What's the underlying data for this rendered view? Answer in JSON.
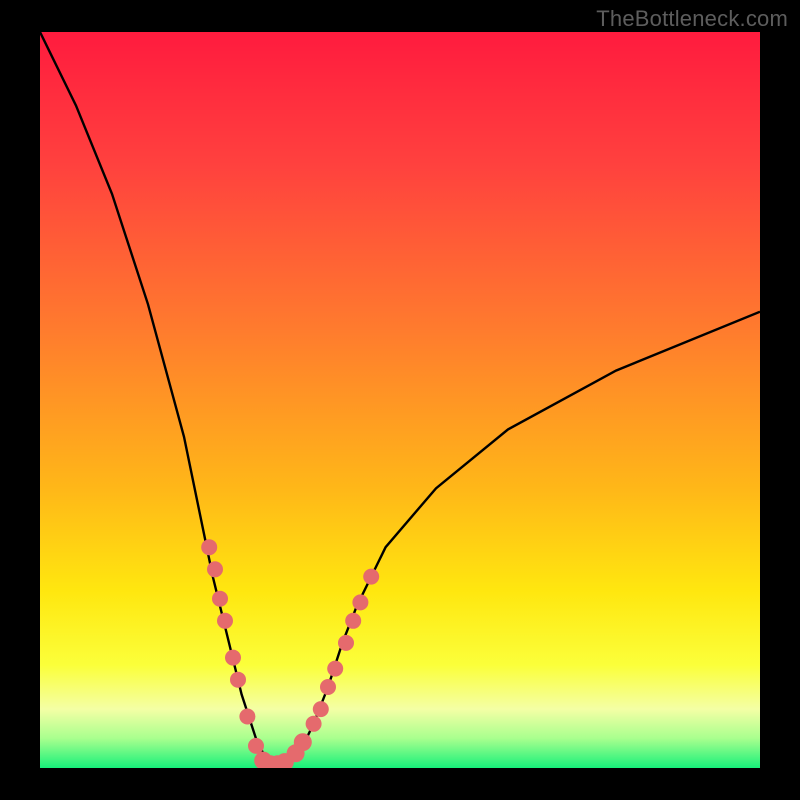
{
  "watermark": "TheBottleneck.com",
  "gradient_stops": {
    "c0": "#ff1b3e",
    "c1": "#ff413e",
    "c2": "#ff7a2e",
    "c3": "#ffb718",
    "c4": "#ffe70f",
    "c5": "#fbff3a",
    "c6": "#f4ffa5",
    "c7": "#a8ff8e",
    "c8": "#17f07a"
  },
  "chart_data": {
    "type": "line",
    "title": "",
    "xlabel": "",
    "ylabel": "",
    "x": [
      0,
      5,
      10,
      15,
      20,
      24,
      26,
      28,
      30,
      32,
      34,
      36,
      38,
      40,
      42,
      44,
      48,
      55,
      65,
      80,
      100
    ],
    "values": [
      100,
      90,
      78,
      63,
      45,
      26,
      18,
      10,
      4,
      0,
      0,
      2,
      6,
      11,
      17,
      22,
      30,
      38,
      46,
      54,
      62
    ],
    "ylim": [
      0,
      100
    ],
    "xlim": [
      0,
      100
    ],
    "series_notes": "V-shaped bottleneck curve; minimum near x≈32 reaching y≈0; left arm steeper than right.",
    "markers": {
      "left_arm": [
        {
          "x": 23.5,
          "y": 30
        },
        {
          "x": 24.3,
          "y": 27
        },
        {
          "x": 25.0,
          "y": 23
        },
        {
          "x": 25.7,
          "y": 20
        },
        {
          "x": 26.8,
          "y": 15
        },
        {
          "x": 27.5,
          "y": 12
        },
        {
          "x": 28.8,
          "y": 7
        },
        {
          "x": 30.0,
          "y": 3
        }
      ],
      "bottom": [
        {
          "x": 31.0,
          "y": 1
        },
        {
          "x": 32.0,
          "y": 0.5
        },
        {
          "x": 33.0,
          "y": 0.5
        },
        {
          "x": 34.0,
          "y": 0.8
        },
        {
          "x": 35.5,
          "y": 2
        },
        {
          "x": 36.5,
          "y": 3.5
        }
      ],
      "right_arm": [
        {
          "x": 38.0,
          "y": 6
        },
        {
          "x": 39.0,
          "y": 8
        },
        {
          "x": 40.0,
          "y": 11
        },
        {
          "x": 41.0,
          "y": 13.5
        },
        {
          "x": 42.5,
          "y": 17
        },
        {
          "x": 43.5,
          "y": 20
        },
        {
          "x": 44.5,
          "y": 22.5
        },
        {
          "x": 46.0,
          "y": 26
        }
      ]
    },
    "marker_color": "#e56a6d",
    "line_color": "#000000"
  }
}
